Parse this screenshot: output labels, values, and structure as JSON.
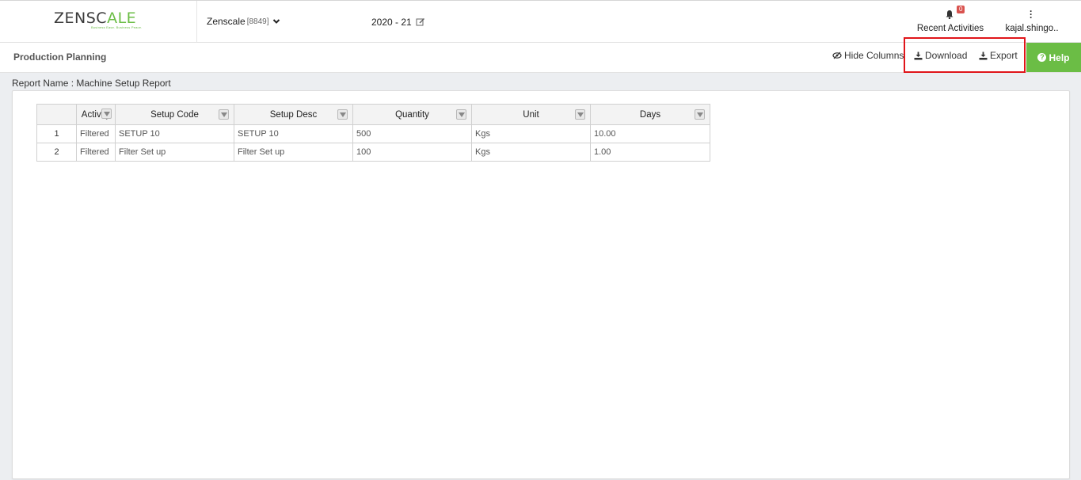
{
  "header": {
    "logo": {
      "text_part1": "ZENSC",
      "text_accent": "A",
      "text_part2": "LE",
      "tagline": "Business Ease. Business Peace."
    },
    "company": {
      "name": "Zenscale",
      "code": "[8849]"
    },
    "financial_year": "2020 - 21",
    "recent_activities": {
      "label": "Recent Activities",
      "badge_count": "0"
    },
    "user": {
      "name": "kajal.shingo.."
    }
  },
  "subheader": {
    "module_title": "Production Planning",
    "hide_columns_label": "Hide Columns",
    "download_label": "Download",
    "export_label": "Export",
    "help_label": "Help"
  },
  "report": {
    "name_label": "Report Name : Machine Setup Report"
  },
  "table": {
    "columns": [
      "",
      "Activity",
      "Setup Code",
      "Setup Desc",
      "Quantity",
      "Unit",
      "Days"
    ],
    "rows": [
      {
        "num": "1",
        "activity": "Filtered",
        "setup_code": "SETUP 10",
        "setup_desc": "SETUP 10",
        "quantity": "500",
        "unit": "Kgs",
        "days": "10.00"
      },
      {
        "num": "2",
        "activity": "Filtered",
        "setup_code": "Filter Set up",
        "setup_desc": "Filter Set up",
        "quantity": "100",
        "unit": "Kgs",
        "days": "1.00"
      }
    ]
  },
  "colors": {
    "brand_green": "#6bbd45",
    "highlight_red": "#e0151a",
    "badge_red": "#d9534f"
  }
}
